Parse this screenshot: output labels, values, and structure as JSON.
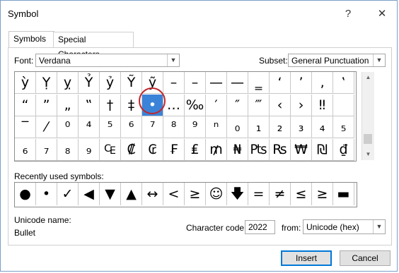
{
  "window": {
    "title": "Symbol",
    "help_label": "?",
    "close_label": "✕"
  },
  "tabs": [
    {
      "label": "Symbols",
      "active": true
    },
    {
      "label": "Special Characters",
      "active": false
    }
  ],
  "font": {
    "label": "Font:",
    "value": "Verdana"
  },
  "subset": {
    "label": "Subset:",
    "value": "General Punctuation"
  },
  "grid": {
    "rows": [
      [
        "ỳ",
        "Ỵ",
        "ỵ",
        "Ỷ",
        "ỷ",
        "Ỹ",
        "ỹ",
        "–",
        "–",
        "—",
        "—",
        "‗",
        "‘",
        "’",
        "‚",
        "‛"
      ],
      [
        "“",
        "”",
        "„",
        "‟",
        "†",
        "‡",
        "•",
        "…",
        "‰",
        "′",
        "″",
        "‴",
        "‹",
        "›",
        "‼",
        ""
      ],
      [
        "‾",
        "⁄",
        "⁰",
        "⁴",
        "⁵",
        "⁶",
        "⁷",
        "⁸",
        "⁹",
        "ⁿ",
        "₀",
        "₁",
        "₂",
        "₃",
        "₄",
        "₅"
      ],
      [
        "₆",
        "₇",
        "₈",
        "₉",
        "₠",
        "₡",
        "₢",
        "₣",
        "₤",
        "₥",
        "₦",
        "₧",
        "₨",
        "₩",
        "₪",
        "₫"
      ]
    ],
    "selected": [
      1,
      6
    ]
  },
  "recent": {
    "label": "Recently used symbols:",
    "symbols": [
      "●",
      "•",
      "✓",
      "◀",
      "▼",
      "▲",
      "↔",
      "<",
      "≥",
      "☺",
      "🡇",
      "=",
      "≠",
      "≤",
      "≥",
      "▬"
    ]
  },
  "unicode_name": {
    "label": "Unicode name:",
    "value": "Bullet"
  },
  "character_code": {
    "label": "Character code:",
    "value": "2022"
  },
  "from": {
    "label": "from:",
    "value": "Unicode (hex)"
  },
  "buttons": {
    "insert": "Insert",
    "cancel": "Cancel"
  }
}
